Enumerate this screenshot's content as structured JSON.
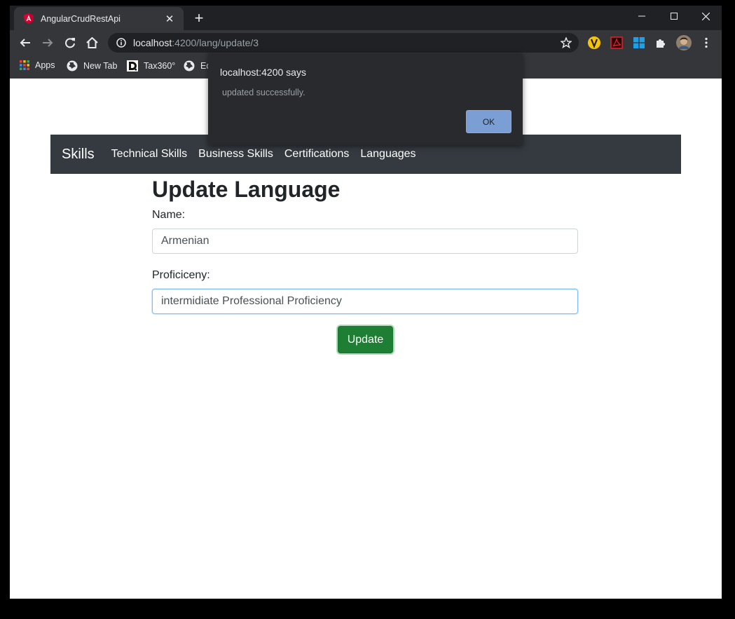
{
  "browser": {
    "tab": {
      "title": "AngularCrudRestApi",
      "close": "✕"
    },
    "new_tab": "+",
    "omnibox": {
      "host": "localhost",
      "path": ":4200/lang/update/3"
    },
    "bookmarks": [
      {
        "label": "Apps",
        "icon": "apps-grid-icon"
      },
      {
        "label": "New Tab",
        "icon": "globe-icon"
      },
      {
        "label": "Tax360°",
        "icon": "d-logo-icon"
      },
      {
        "label": "Ed",
        "icon": "globe-icon"
      }
    ]
  },
  "dialog": {
    "title": "localhost:4200 says",
    "message": "updated successfully.",
    "ok_label": "OK"
  },
  "navbar": {
    "brand": "Skills",
    "links": [
      "Technical Skills",
      "Business Skills",
      "Certifications",
      "Languages"
    ]
  },
  "form": {
    "title": "Update Language",
    "name_label": "Name:",
    "name_value": "Armenian",
    "proficiency_label": "Proficiceny:",
    "proficiency_value": "intermidiate Professional Proficiency",
    "submit_label": "Update"
  },
  "colors": {
    "navbar_bg": "#343a40",
    "button_bg": "#1e7e34",
    "dialog_bg": "#292a2d",
    "ok_button_bg": "#7b9fd4"
  }
}
